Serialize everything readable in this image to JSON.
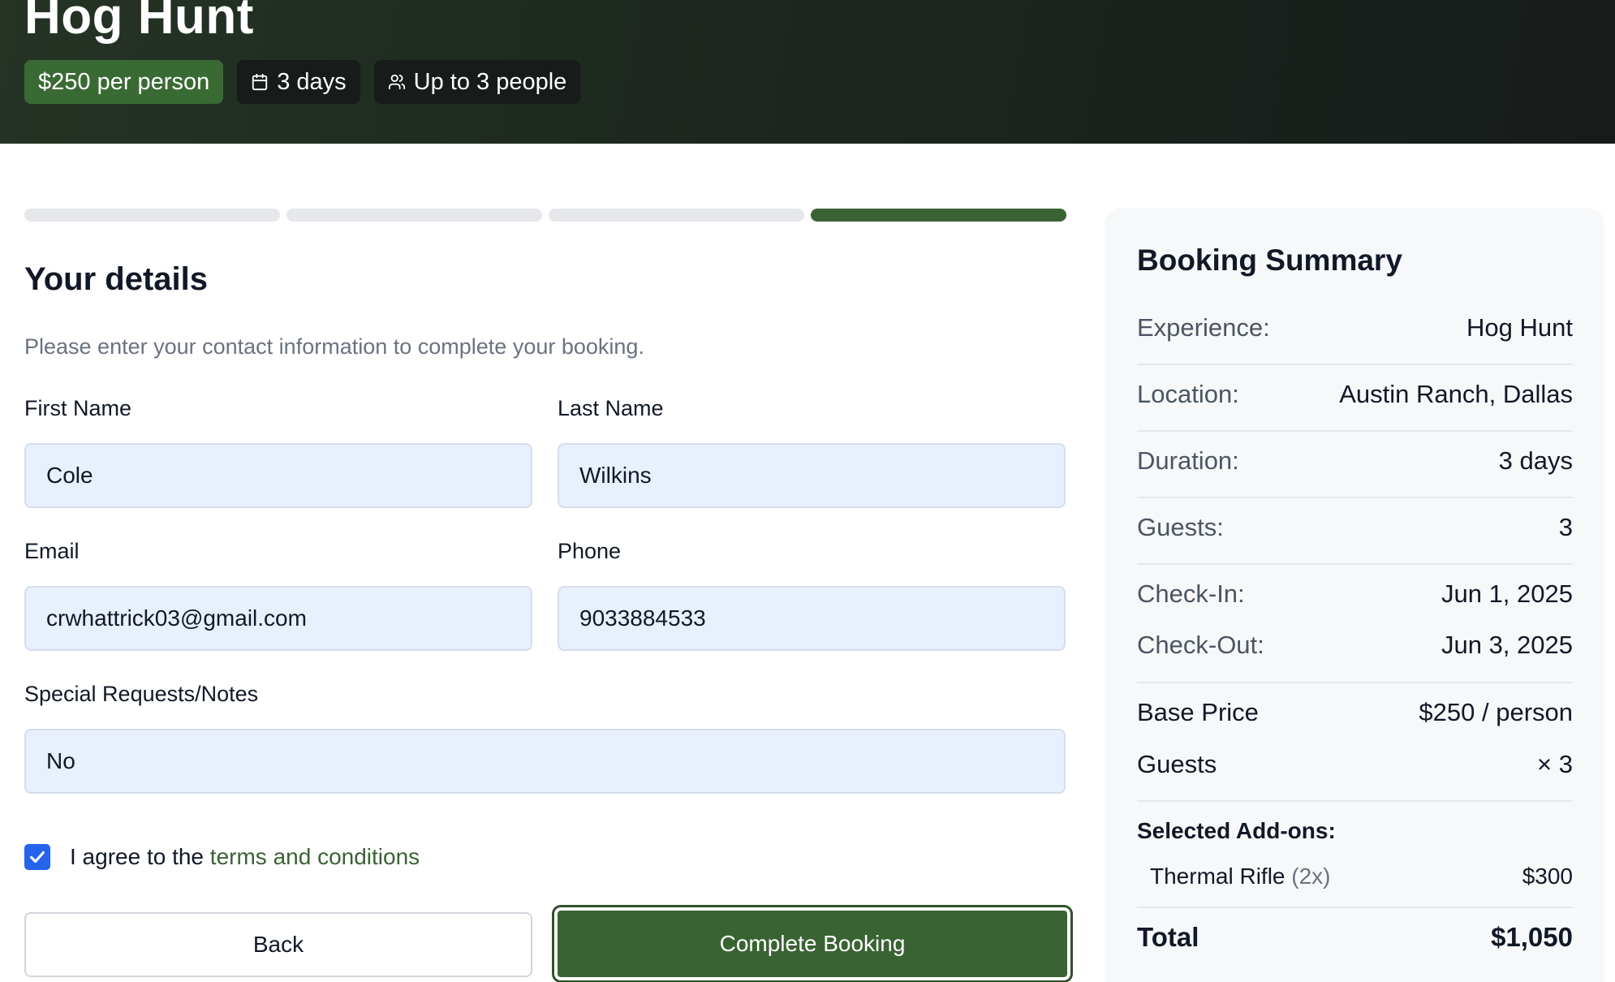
{
  "hero": {
    "title": "Hog Hunt",
    "price_chip": "$250 per person",
    "duration_chip": "3 days",
    "capacity_chip": "Up to 3 people"
  },
  "progress": {
    "total_steps": 4,
    "current_step": 4
  },
  "form": {
    "title": "Your details",
    "description": "Please enter your contact information to complete your booking.",
    "first_name": {
      "label": "First Name",
      "value": "Cole"
    },
    "last_name": {
      "label": "Last Name",
      "value": "Wilkins"
    },
    "email": {
      "label": "Email",
      "value": "crwhattrick03@gmail.com"
    },
    "phone": {
      "label": "Phone",
      "value": "9033884533"
    },
    "notes": {
      "label": "Special Requests/Notes",
      "value": "No"
    },
    "agree_prefix": "I agree to the ",
    "agree_link": "terms and conditions",
    "agree_checked": true,
    "back_label": "Back",
    "complete_label": "Complete Booking"
  },
  "summary": {
    "title": "Booking Summary",
    "experience": {
      "key": "Experience:",
      "value": "Hog Hunt"
    },
    "location": {
      "key": "Location:",
      "value": "Austin Ranch, Dallas"
    },
    "duration": {
      "key": "Duration:",
      "value": "3 days"
    },
    "guests": {
      "key": "Guests:",
      "value": "3"
    },
    "check_in": {
      "key": "Check-In:",
      "value": "Jun 1, 2025"
    },
    "check_out": {
      "key": "Check-Out:",
      "value": "Jun 3, 2025"
    },
    "base_price": {
      "key": "Base Price",
      "value": "$250 / person"
    },
    "guests_multiplier": {
      "key": "Guests",
      "value": "× 3"
    },
    "addons_title": "Selected Add-ons:",
    "addon": {
      "name": "Thermal Rifle",
      "qty": "(2x)",
      "price": "$300"
    },
    "total": {
      "key": "Total",
      "value": "$1,050"
    }
  },
  "colors": {
    "brand_green": "#3a6334",
    "input_bg": "#e8effd",
    "checkbox_blue": "#2563eb"
  }
}
